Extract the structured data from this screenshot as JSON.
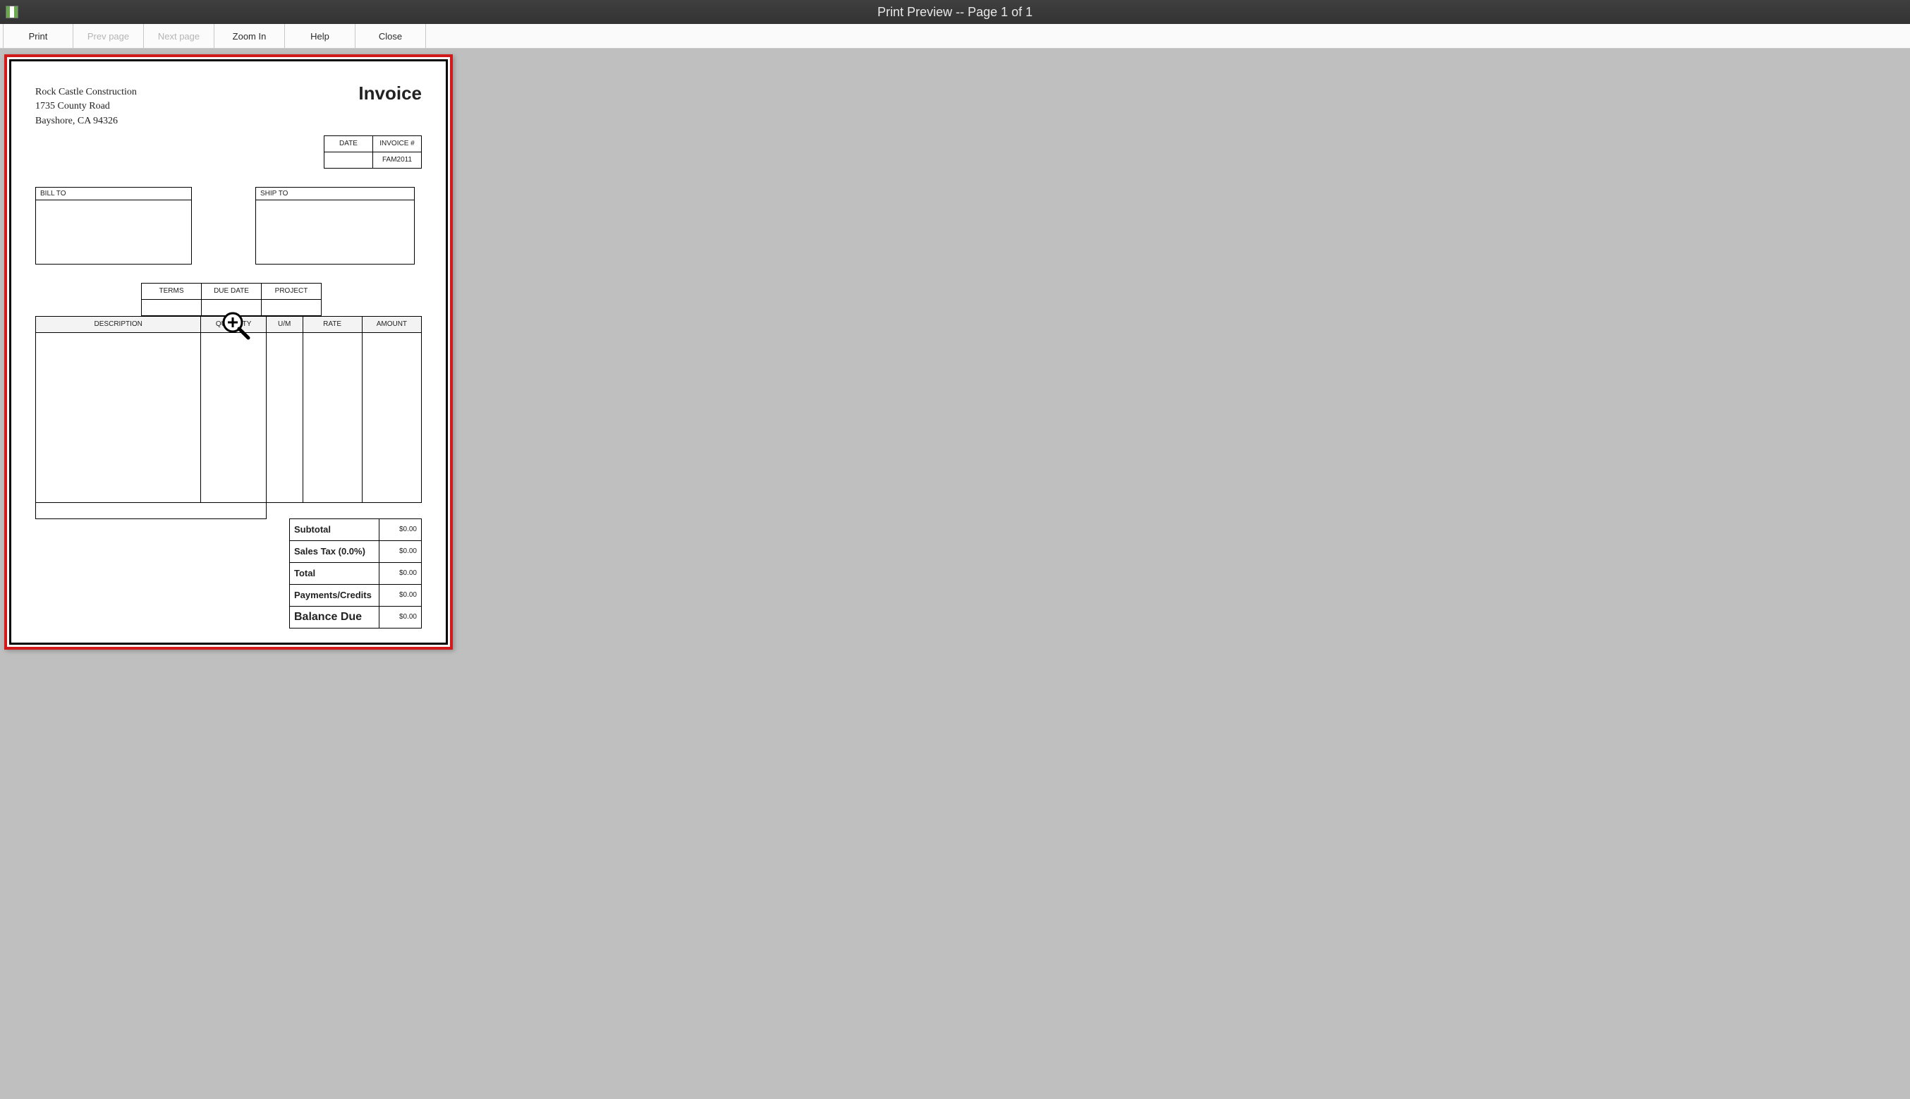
{
  "window": {
    "title": "Print Preview -- Page 1 of 1"
  },
  "toolbar": {
    "print": "Print",
    "prev_page": "Prev page",
    "next_page": "Next page",
    "zoom_in": "Zoom In",
    "help": "Help",
    "close": "Close"
  },
  "invoice": {
    "company_name": "Rock Castle Construction",
    "company_addr1": "1735 County Road",
    "company_addr2": "Bayshore, CA 94326",
    "doc_title": "Invoice",
    "meta": {
      "date_label": "DATE",
      "invno_label": "INVOICE #",
      "date_value": "",
      "invno_value": "FAM2011"
    },
    "bill_to_label": "BILL TO",
    "ship_to_label": "SHIP TO",
    "terms_row": {
      "terms_label": "TERMS",
      "due_date_label": "DUE DATE",
      "project_label": "PROJECT"
    },
    "columns": {
      "description": "DESCRIPTION",
      "quantity": "QUANTITY",
      "um": "U/M",
      "rate": "RATE",
      "amount": "AMOUNT"
    },
    "totals": {
      "subtotal_label": "Subtotal",
      "subtotal_value": "$0.00",
      "sales_tax_label": "Sales Tax  (0.0%)",
      "sales_tax_value": "$0.00",
      "total_label": "Total",
      "total_value": "$0.00",
      "payments_credits_label": "Payments/Credits",
      "payments_credits_value": "$0.00",
      "balance_due_label": "Balance Due",
      "balance_due_value": "$0.00"
    }
  }
}
